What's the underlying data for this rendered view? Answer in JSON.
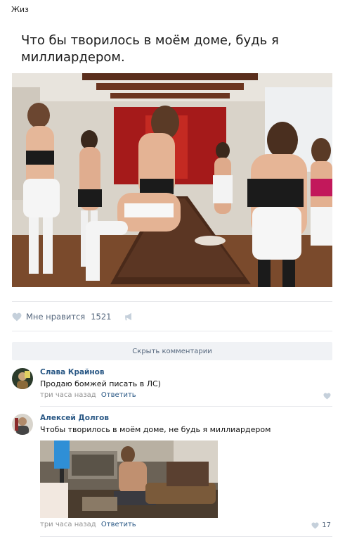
{
  "group": {
    "name": "Жиз"
  },
  "post": {
    "text": "Что бы творилось в моём доме, будь я миллиардером.",
    "likes_label": "Мне нравится",
    "likes_count": "1521"
  },
  "comments_toggle": {
    "label": "Скрыть комментарии"
  },
  "comments": [
    {
      "author": "Слава Крайнов",
      "text": "Продаю бомжей писать в ЛС)",
      "time": "три часа назад",
      "reply_label": "Ответить",
      "likes": ""
    },
    {
      "author": "Алексей Долгов",
      "text": "Чтобы творилось в моём доме, не будь я миллиардером",
      "time": "три часа назад",
      "reply_label": "Ответить",
      "likes": "17"
    }
  ],
  "icons": {
    "like": "heart-icon",
    "share": "megaphone-icon"
  },
  "colors": {
    "link": "#2a5885",
    "muted": "#55677d",
    "meta": "#939393",
    "divider": "#e7e8ec",
    "button_bg": "#f0f2f5"
  }
}
